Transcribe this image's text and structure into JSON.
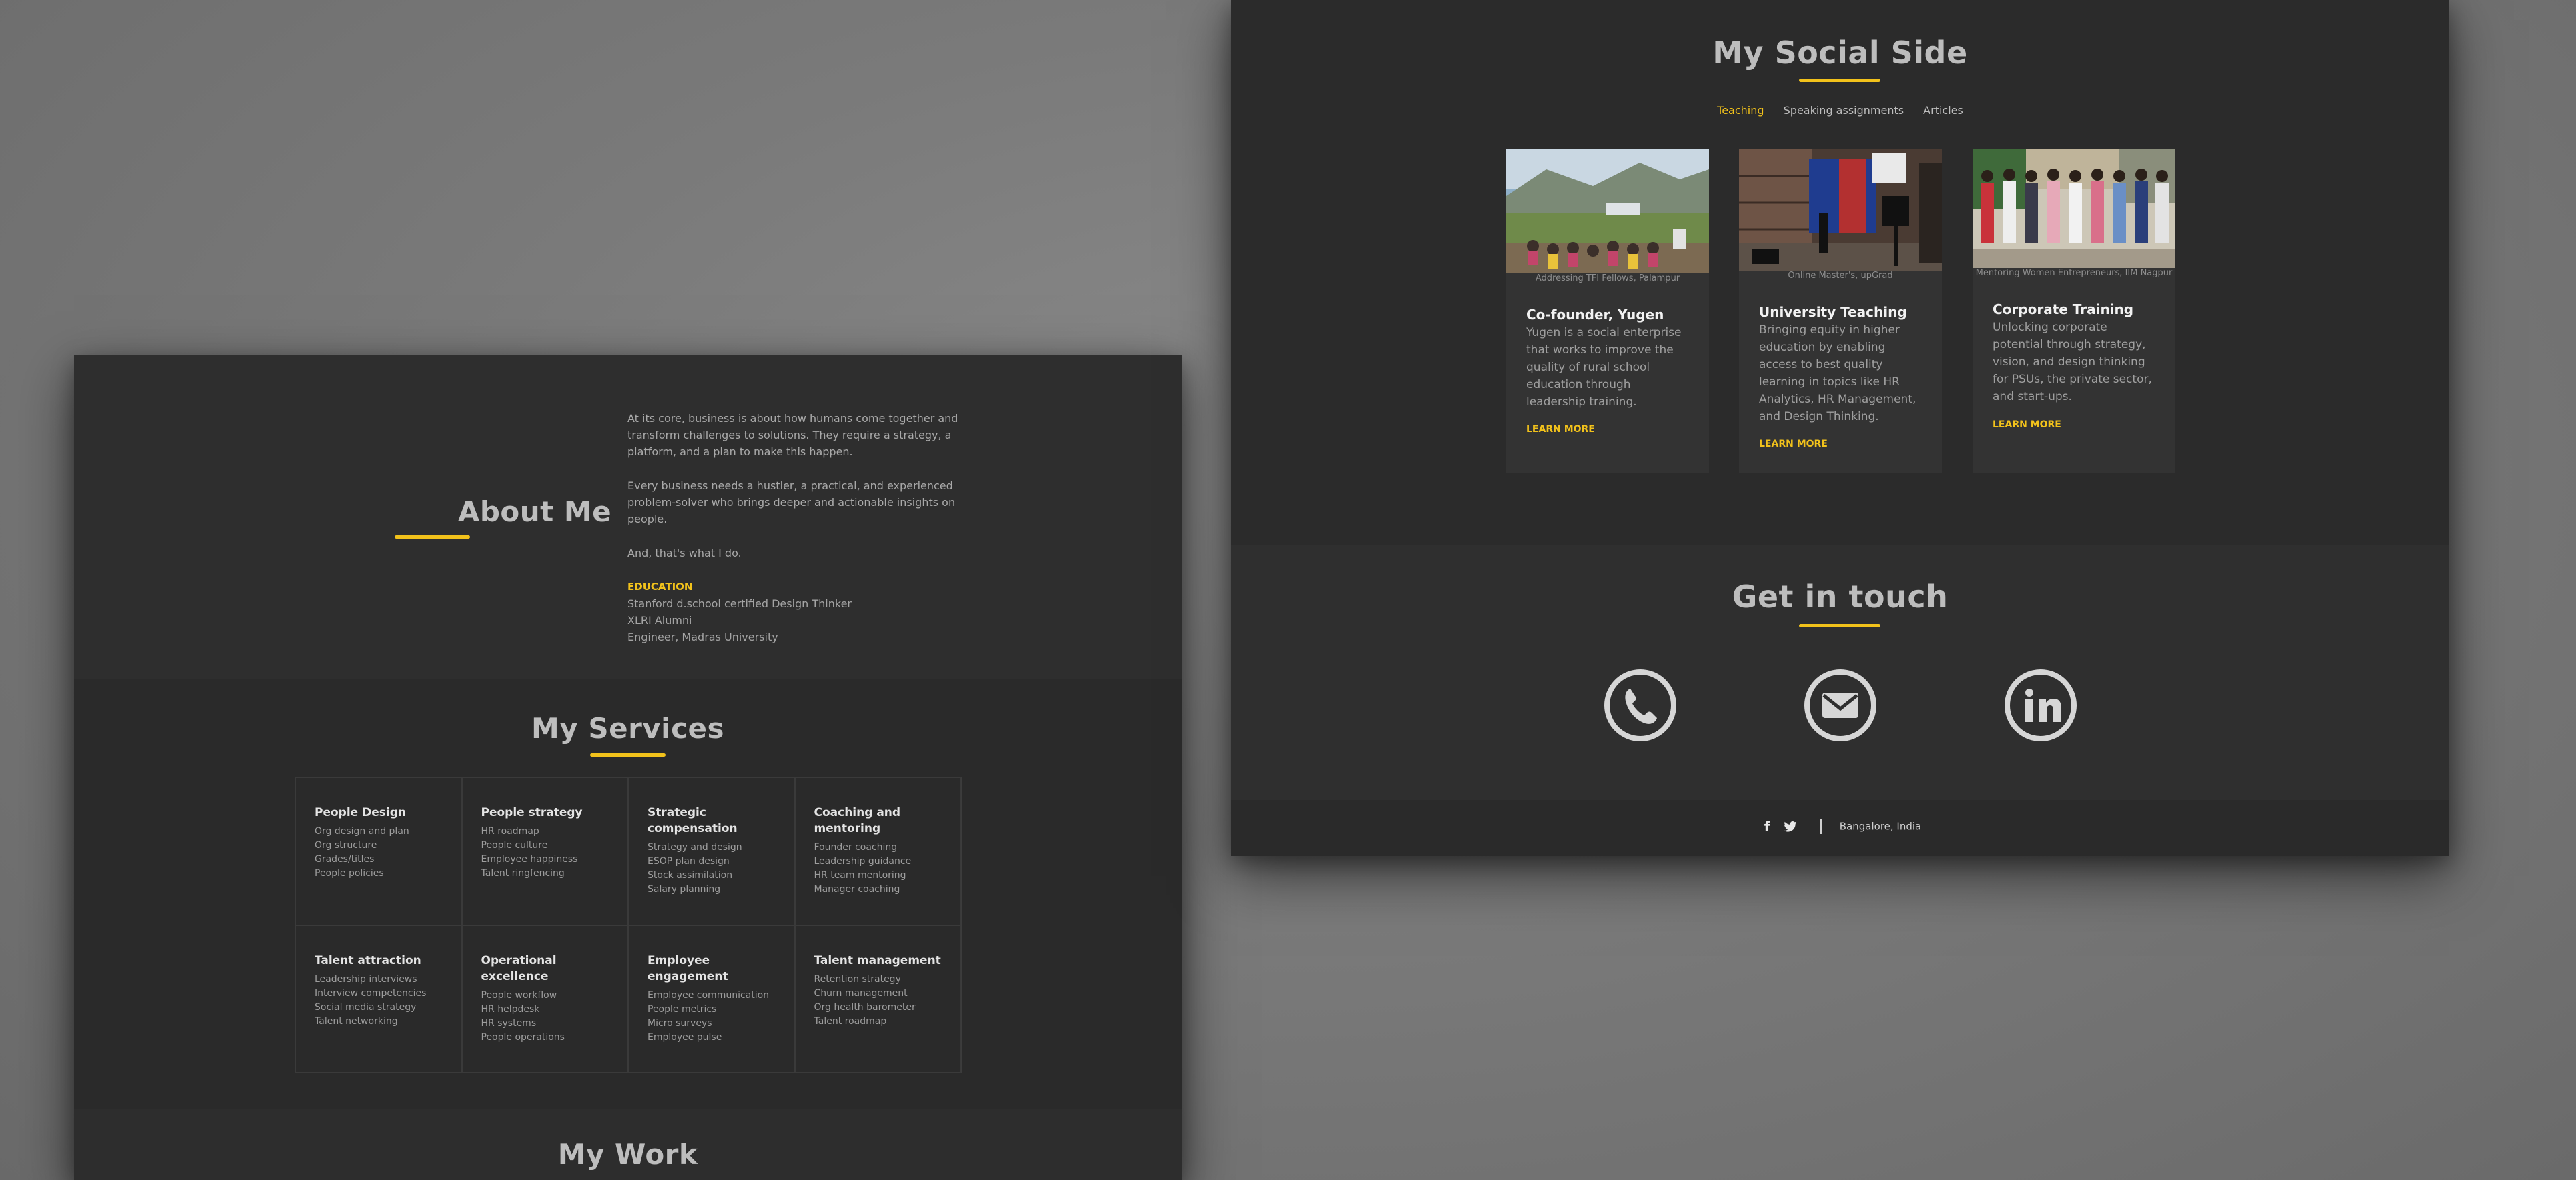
{
  "about": {
    "title": "About Me",
    "paragraphs": [
      "At its core, business is about how humans come together and transform challenges to solutions. They require a strategy, a platform, and a plan to make this happen.",
      "Every business needs a hustler, a practical, and experienced problem-solver who brings deeper and actionable insights on people.",
      "And, that's what I do."
    ],
    "education_label": "EDUCATION",
    "education": [
      "Stanford d.school certified Design Thinker",
      "XLRI Alumni",
      "Engineer, Madras University"
    ]
  },
  "services": {
    "title": "My Services",
    "items": [
      {
        "title": "People Design",
        "lines": [
          "Org design and plan",
          "Org structure",
          "Grades/titles",
          "People policies"
        ]
      },
      {
        "title": "People strategy",
        "lines": [
          "HR roadmap",
          "People culture",
          "Employee happiness",
          "Talent ringfencing"
        ]
      },
      {
        "title": "Strategic compensation",
        "lines": [
          "Strategy and design",
          "ESOP plan design",
          "Stock assimilation",
          "Salary planning"
        ]
      },
      {
        "title": "Coaching and mentoring",
        "lines": [
          "Founder coaching",
          "Leadership guidance",
          "HR team mentoring",
          "Manager coaching"
        ]
      },
      {
        "title": "Talent attraction",
        "lines": [
          "Leadership interviews",
          "Interview competencies",
          "Social media strategy",
          "Talent networking"
        ]
      },
      {
        "title": "Operational excellence",
        "lines": [
          "People workflow",
          "HR helpdesk",
          "HR systems",
          "People operations"
        ]
      },
      {
        "title": "Employee engagement",
        "lines": [
          "Employee communication",
          "People metrics",
          "Micro surveys",
          "Employee pulse"
        ]
      },
      {
        "title": "Talent management",
        "lines": [
          "Retention strategy",
          "Churn management",
          "Org health barometer",
          "Talent roadmap"
        ]
      }
    ]
  },
  "work": {
    "title": "My Work"
  },
  "social": {
    "title": "My Social Side",
    "tabs": [
      "Teaching",
      "Speaking assignments",
      "Articles"
    ],
    "active_tab": "Teaching",
    "cards": [
      {
        "caption": "Addressing TFI Fellows, Palampur",
        "title": "Co-founder, Yugen",
        "desc": "Yugen is a social enterprise that works to improve the quality of rural school education through leadership training.",
        "link": "LEARN MORE"
      },
      {
        "caption": "Online Master's, upGrad",
        "title": "University Teaching",
        "desc": "Bringing equity in higher education by enabling access to best quality learning in topics like HR Analytics, HR Management, and Design Thinking.",
        "link": "LEARN MORE"
      },
      {
        "caption": "Mentoring Women Entrepreneurs, IIM Nagpur",
        "title": "Corporate Training",
        "desc": "Unlocking corporate potential through strategy, vision, and design thinking for PSUs, the private sector, and start-ups.",
        "link": "LEARN MORE"
      }
    ]
  },
  "contact": {
    "title": "Get in touch",
    "icons": [
      "phone-icon",
      "email-icon",
      "linkedin-icon"
    ]
  },
  "footer": {
    "facebook_glyph": "f",
    "location": "Bangalore, India"
  },
  "colors": {
    "accent": "#f2c21b",
    "panel": "#2c2c2c",
    "background": "#7a7a7a"
  }
}
